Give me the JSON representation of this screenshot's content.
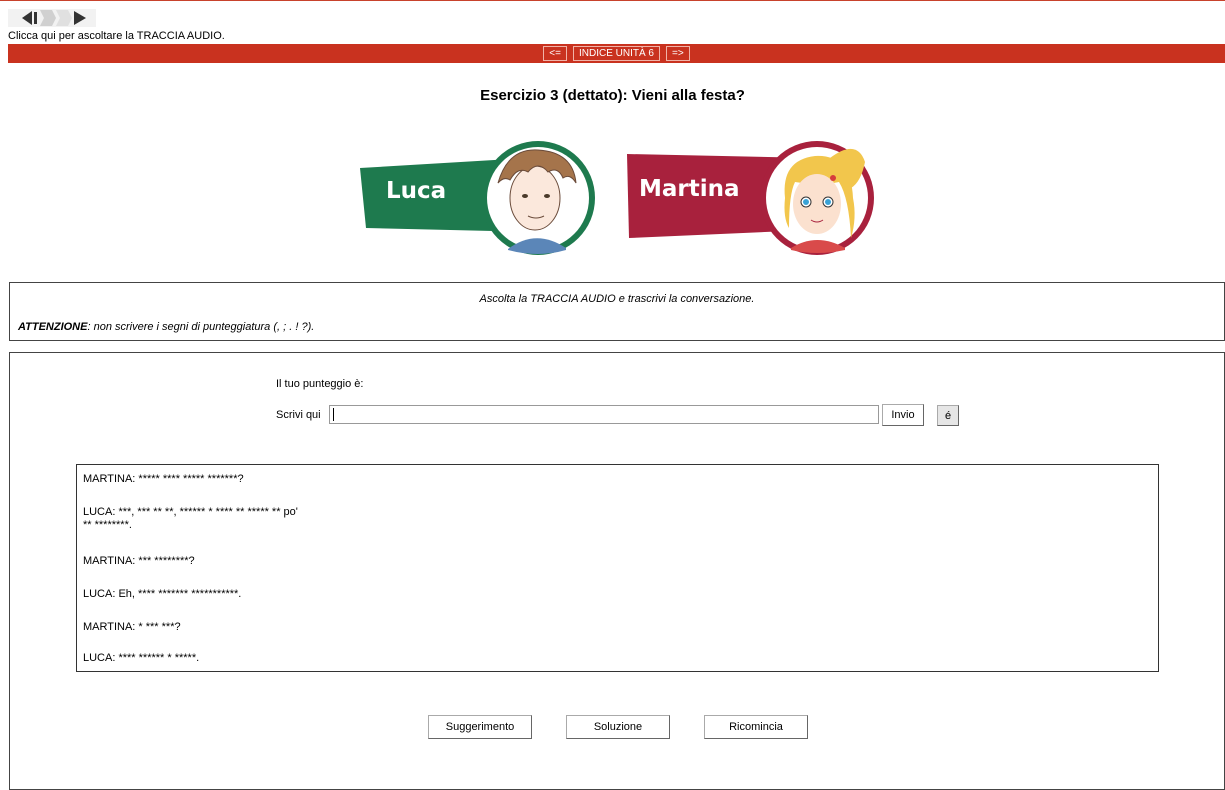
{
  "audio": {
    "caption": "Clicca qui per ascoltare la TRACCIA AUDIO."
  },
  "nav": {
    "prev_label": "<=",
    "index_label": "INDICE UNITÀ 6",
    "next_label": "=>"
  },
  "exercise": {
    "title": "Esercizio 3 (dettato): Vieni alla festa?"
  },
  "characters": [
    {
      "name": "Luca",
      "color": "#1e7a4e"
    },
    {
      "name": "Martina",
      "color": "#a8213d"
    }
  ],
  "instructions": {
    "line1": "Ascolta la TRACCIA AUDIO e trascrivi la conversazione.",
    "attention_label": "ATTENZIONE",
    "line2": ": non scrivere i segni di punteggiatura (, ; . ! ?)."
  },
  "form": {
    "score_label": "Il tuo punteggio è:",
    "write_label": "Scrivi qui",
    "input_value": "",
    "send_label": "Invio",
    "accent_label": "é"
  },
  "dialogue": [
    "MARTINA: ***** **** ***** *******?",
    "LUCA: ***, *** ** **, ****** * **** ** ***** ** po'",
    "** ********.",
    "MARTINA: *** ********?",
    "LUCA: Eh, **** ******* ***********.",
    "MARTINA: * *** ***?",
    "LUCA: **** ****** * *****."
  ],
  "buttons": {
    "hint": "Suggerimento",
    "solution": "Soluzione",
    "restart": "Ricomincia"
  },
  "colors": {
    "nav_bar": "#c9321f",
    "luca_green": "#1e7a4e",
    "martina_red": "#a8213d"
  }
}
